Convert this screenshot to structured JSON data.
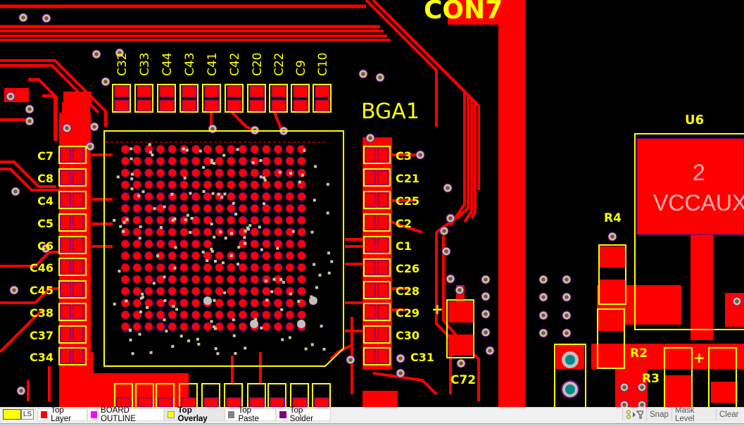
{
  "app": "PCB Layout Editor",
  "colors": {
    "background": "#000000",
    "top_layer": "#ff0000",
    "board_outline": "#ff00ff",
    "top_overlay": "#ffff00",
    "top_paste": "#808080",
    "top_solder": "#800080",
    "via_ring": "#c0c0c0",
    "via_hole": "#7a5a10",
    "through_hole": "#008b8b"
  },
  "designators": {
    "con": "CON7",
    "bga": "BGA1",
    "u6": "U6",
    "u6_pad_number": "2",
    "u6_pad_net": "VCCAUX",
    "r4": "R4",
    "r2": "R2",
    "r3": "R3",
    "c72": "C72",
    "plus_a": "+",
    "plus_b": "+",
    "top_caps": [
      "C32",
      "C33",
      "C44",
      "C43",
      "C41",
      "C42",
      "C20",
      "C22",
      "C9",
      "C10"
    ],
    "left_caps": [
      "C7",
      "C8",
      "C4",
      "C5",
      "C6",
      "C46",
      "C45",
      "C38",
      "C37",
      "C34"
    ],
    "right_caps": [
      "C3",
      "C21",
      "C25",
      "C2",
      "C1",
      "C26",
      "C28",
      "C29",
      "C30",
      "C31"
    ]
  },
  "statusbar": {
    "current_layer_label": "LS",
    "layer_tabs": [
      {
        "label": "Top Layer",
        "color": "#ff0000",
        "active": false
      },
      {
        "label": "BOARD OUTLINE",
        "color": "#ff00ff",
        "active": false
      },
      {
        "label": "Top Overlay",
        "color": "#ffff00",
        "active": true
      },
      {
        "label": "Top Paste",
        "color": "#808080",
        "active": false
      },
      {
        "label": "Top Solder",
        "color": "#800080",
        "active": false
      }
    ],
    "filter_icon": "filter-icon",
    "snap_label": "Snap",
    "mask_level_label": "Mask Level",
    "clear_label": "Clear"
  }
}
